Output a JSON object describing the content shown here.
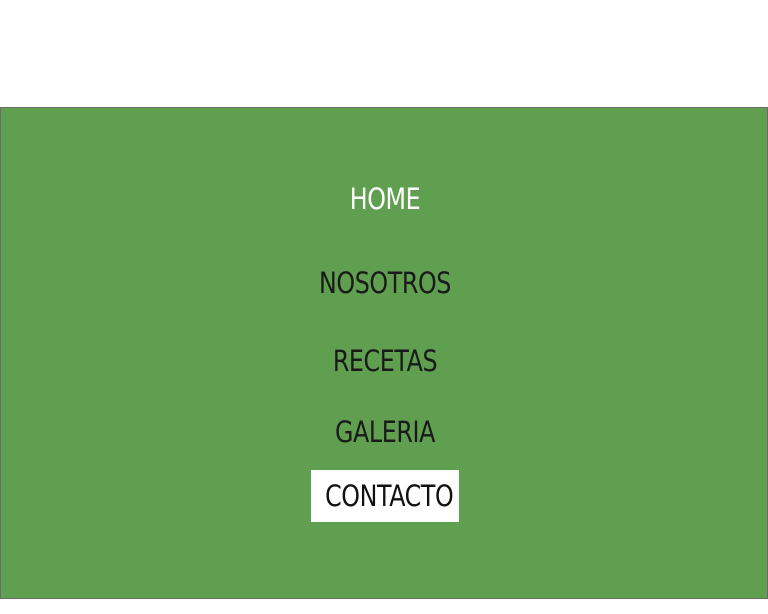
{
  "nav": {
    "items": [
      {
        "label": "HOME",
        "state": "current"
      },
      {
        "label": "NOSOTROS",
        "state": "default"
      },
      {
        "label": "RECETAS",
        "state": "default"
      },
      {
        "label": "GALERIA",
        "state": "default"
      },
      {
        "label": "CONTACTO",
        "state": "highlighted"
      }
    ]
  },
  "colors": {
    "nav_background": "#609f4f",
    "nav_text": "#1a1a1a",
    "current_text": "#ffffff",
    "highlight_background": "#ffffff"
  }
}
